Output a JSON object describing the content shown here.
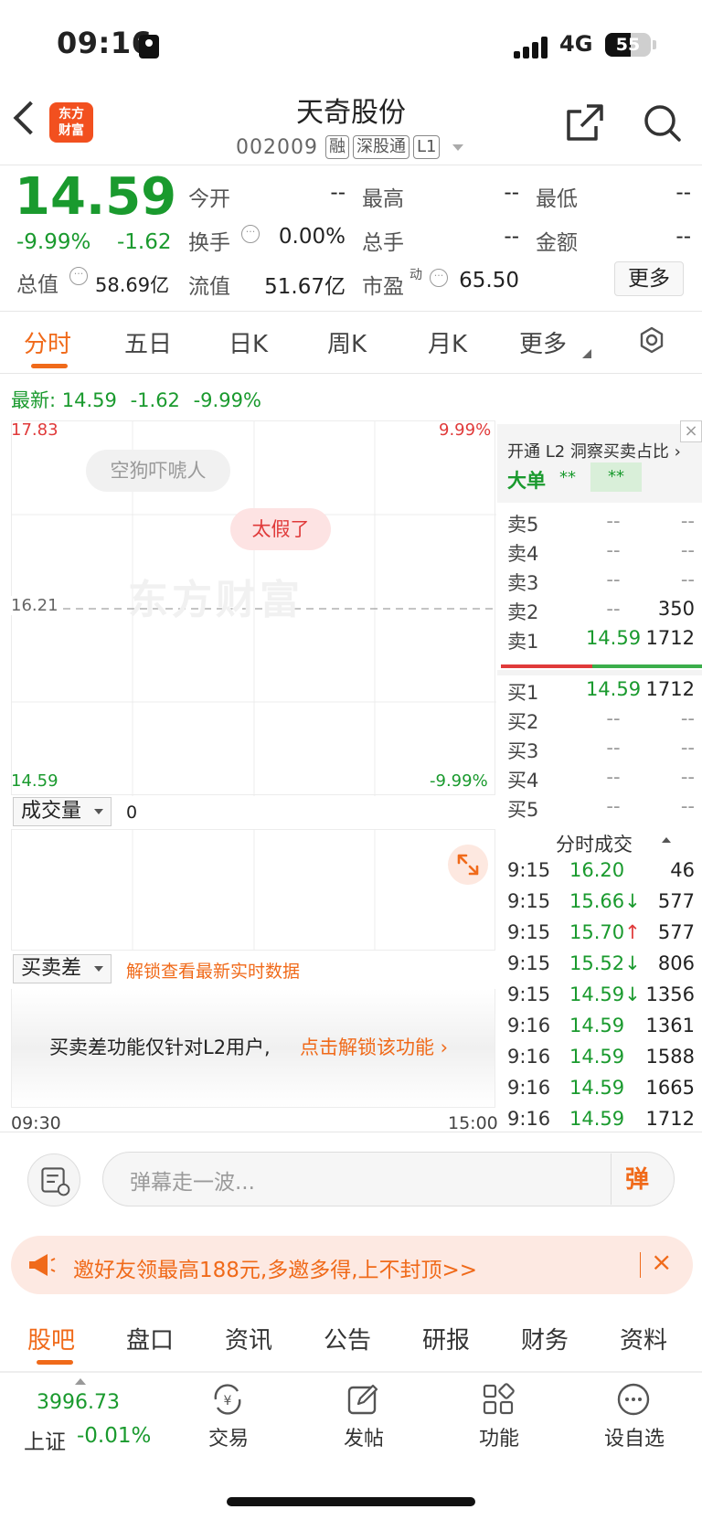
{
  "status_bar": {
    "time": "09:16",
    "network": "4G",
    "battery": "55",
    "battery_level": 0.55
  },
  "header": {
    "logo_line1": "东方",
    "logo_line2": "财富",
    "stock_name": "天奇股份",
    "stock_code": "002009",
    "tags": [
      "融",
      "深股通",
      "L1"
    ]
  },
  "quote": {
    "price": "14.59",
    "change_pct": "-9.99%",
    "change": "-1.62",
    "total_mkt_label": "总值",
    "total_mkt_value": "58.69亿",
    "open_label": "今开",
    "open_value": "--",
    "high_label": "最高",
    "high_value": "--",
    "low_label": "最低",
    "low_value": "--",
    "turnover_label": "换手",
    "turnover_value": "0.00%",
    "volume_label": "总手",
    "volume_value": "--",
    "amount_label": "金额",
    "amount_value": "--",
    "float_label": "流值",
    "float_value": "51.67亿",
    "pe_label": "市盈",
    "pe_sup": "动",
    "pe_value": "65.50",
    "more_label": "更多"
  },
  "tabs": [
    "分时",
    "五日",
    "日K",
    "周K",
    "月K",
    "更多"
  ],
  "latest": {
    "label": "最新:",
    "price": "14.59",
    "change": "-1.62",
    "pct": "-9.99%"
  },
  "chart": {
    "y_top": "17.83",
    "y_mid": "16.21",
    "y_bottom": "14.59",
    "pct_top": "9.99%",
    "pct_bottom": "-9.99%",
    "comment_1": "空狗吓唬人",
    "comment_2": "太假了",
    "watermark": "东方财富",
    "volume_select": "成交量",
    "volume_value": "0",
    "spread_select": "买卖差",
    "unlock_link": "解锁查看最新实时数据",
    "spread_text": "买卖差功能仅针对L2用户,",
    "spread_link": "点击解锁该功能",
    "time_start": "09:30",
    "time_end": "15:00"
  },
  "order_book": {
    "l2_promo": "开通 L2 洞察买卖占比",
    "big_order_label": "大单",
    "big_order_v1": "**",
    "big_order_v2": "**",
    "close": "×",
    "sells": [
      {
        "label": "卖5",
        "price": "--",
        "volume": "--"
      },
      {
        "label": "卖4",
        "price": "--",
        "volume": "--"
      },
      {
        "label": "卖3",
        "price": "--",
        "volume": "--"
      },
      {
        "label": "卖2",
        "price": "--",
        "volume": "350"
      },
      {
        "label": "卖1",
        "price": "14.59",
        "volume": "1712"
      }
    ],
    "buys": [
      {
        "label": "买1",
        "price": "14.59",
        "volume": "1712"
      },
      {
        "label": "买2",
        "price": "--",
        "volume": "--"
      },
      {
        "label": "买3",
        "price": "--",
        "volume": "--"
      },
      {
        "label": "买4",
        "price": "--",
        "volume": "--"
      },
      {
        "label": "买5",
        "price": "--",
        "volume": "--"
      }
    ],
    "trades_title": "分时成交",
    "trades": [
      {
        "time": "9:15",
        "price": "16.20",
        "arrow": "",
        "volume": "46"
      },
      {
        "time": "9:15",
        "price": "15.66",
        "arrow": "↓",
        "volume": "577"
      },
      {
        "time": "9:15",
        "price": "15.70",
        "arrow": "↑",
        "volume": "577"
      },
      {
        "time": "9:15",
        "price": "15.52",
        "arrow": "↓",
        "volume": "806"
      },
      {
        "time": "9:15",
        "price": "14.59",
        "arrow": "↓",
        "volume": "1356"
      },
      {
        "time": "9:16",
        "price": "14.59",
        "arrow": "",
        "volume": "1361"
      },
      {
        "time": "9:16",
        "price": "14.59",
        "arrow": "",
        "volume": "1588"
      },
      {
        "time": "9:16",
        "price": "14.59",
        "arrow": "",
        "volume": "1665"
      },
      {
        "time": "9:16",
        "price": "14.59",
        "arrow": "",
        "volume": "1712"
      }
    ]
  },
  "danmaku": {
    "placeholder": "弹幕走一波...",
    "send_label": "弹"
  },
  "promo": {
    "text": "邀好友领最高188元,多邀多得,上不封顶>>",
    "close": "×"
  },
  "bottom_tabs": [
    "股吧",
    "盘口",
    "资讯",
    "公告",
    "研报",
    "财务",
    "资料"
  ],
  "toolbar": {
    "index_value": "3996.73",
    "index_name": "上证",
    "index_change": "-0.01%",
    "items": [
      "交易",
      "发帖",
      "功能",
      "设自选"
    ]
  },
  "colors": {
    "up": "#e03a3a",
    "down": "#1a9a2e",
    "accent": "#f06a1a"
  }
}
